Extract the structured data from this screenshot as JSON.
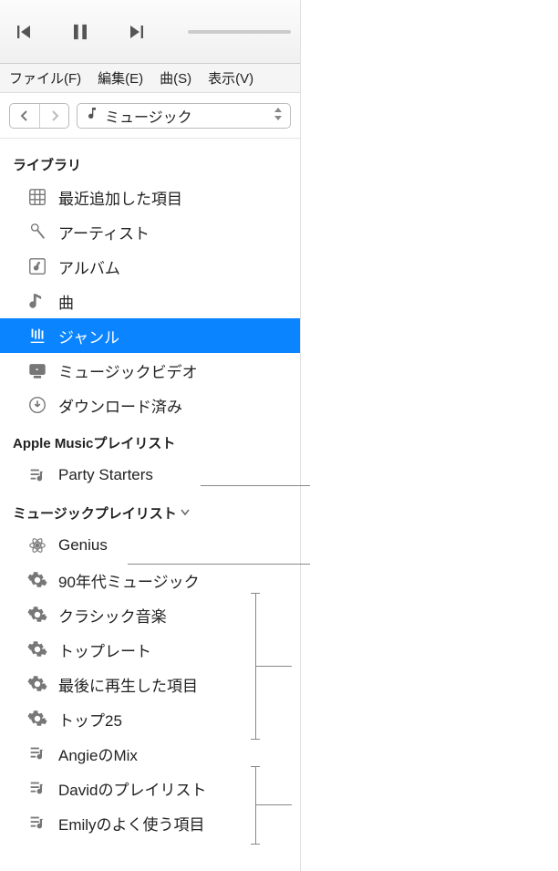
{
  "menubar": {
    "file": "ファイル(F)",
    "edit": "編集(E)",
    "song": "曲(S)",
    "view": "表示(V)"
  },
  "category_select": {
    "label": "ミュージック"
  },
  "sidebar": {
    "library_header": "ライブラリ",
    "library_items": [
      {
        "icon": "grid",
        "label": "最近追加した項目"
      },
      {
        "icon": "mic",
        "label": "アーティスト"
      },
      {
        "icon": "album",
        "label": "アルバム"
      },
      {
        "icon": "note",
        "label": "曲"
      },
      {
        "icon": "genre",
        "label": "ジャンル",
        "selected": true
      },
      {
        "icon": "video",
        "label": "ミュージックビデオ"
      },
      {
        "icon": "download",
        "label": "ダウンロード済み"
      }
    ],
    "apple_music_header": "Apple Musicプレイリスト",
    "apple_music_items": [
      {
        "icon": "playlist",
        "label": "Party Starters"
      }
    ],
    "music_playlist_header": "ミュージックプレイリスト",
    "music_playlist_items": [
      {
        "icon": "genius",
        "label": "Genius"
      },
      {
        "icon": "gear",
        "label": "90年代ミュージック"
      },
      {
        "icon": "gear",
        "label": "クラシック音楽"
      },
      {
        "icon": "gear",
        "label": "トップレート"
      },
      {
        "icon": "gear",
        "label": "最後に再生した項目"
      },
      {
        "icon": "gear",
        "label": "トップ25"
      },
      {
        "icon": "playlist",
        "label": "AngieのMix"
      },
      {
        "icon": "playlist",
        "label": "Davidのプレイリスト"
      },
      {
        "icon": "playlist",
        "label": "Emilyのよく使う項目"
      }
    ]
  }
}
